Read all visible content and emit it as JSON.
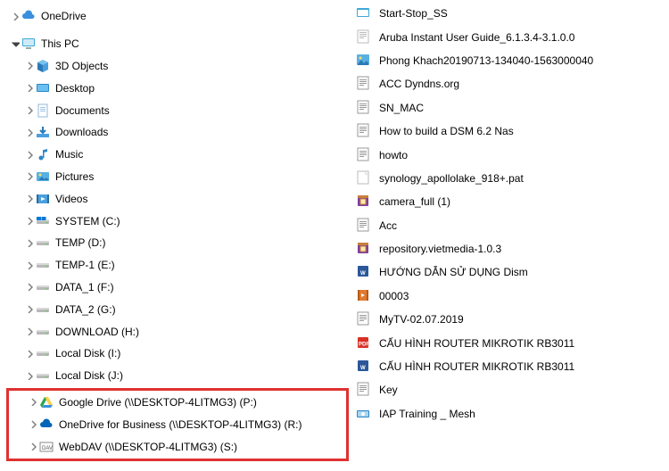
{
  "tree": {
    "onedrive_label": "OneDrive",
    "thispc_label": "This PC",
    "items": [
      {
        "label": "3D Objects"
      },
      {
        "label": "Desktop"
      },
      {
        "label": "Documents"
      },
      {
        "label": "Downloads"
      },
      {
        "label": "Music"
      },
      {
        "label": "Pictures"
      },
      {
        "label": "Videos"
      },
      {
        "label": "SYSTEM (C:)"
      },
      {
        "label": "TEMP (D:)"
      },
      {
        "label": "TEMP-1 (E:)"
      },
      {
        "label": "DATA_1 (F:)"
      },
      {
        "label": "DATA_2 (G:)"
      },
      {
        "label": "DOWNLOAD (H:)"
      },
      {
        "label": "Local Disk (I:)"
      },
      {
        "label": "Local Disk (J:)"
      }
    ],
    "network": [
      {
        "label": "Google Drive (\\\\DESKTOP-4LITMG3) (P:)"
      },
      {
        "label": "OneDrive for Business (\\\\DESKTOP-4LITMG3) (R:)"
      },
      {
        "label": "WebDAV (\\\\DESKTOP-4LITMG3) (S:)"
      }
    ]
  },
  "files": [
    {
      "name": "Start-Stop_SS",
      "icon": "app"
    },
    {
      "name": "Aruba Instant User Guide_6.1.3.4-3.1.0.0",
      "icon": "text"
    },
    {
      "name": "Phong Khach20190713-134040-1563000040",
      "icon": "image"
    },
    {
      "name": "ACC Dyndns.org",
      "icon": "txt"
    },
    {
      "name": "SN_MAC",
      "icon": "txt"
    },
    {
      "name": "How to build a DSM 6.2 Nas",
      "icon": "txt"
    },
    {
      "name": "howto",
      "icon": "txt"
    },
    {
      "name": "synology_apollolake_918+.pat",
      "icon": "generic"
    },
    {
      "name": "camera_full (1)",
      "icon": "rar"
    },
    {
      "name": "Acc",
      "icon": "txt"
    },
    {
      "name": "repository.vietmedia-1.0.3",
      "icon": "rar"
    },
    {
      "name": "HƯỚNG DẪN SỬ DỤNG Dism",
      "icon": "word"
    },
    {
      "name": "00003",
      "icon": "video"
    },
    {
      "name": "MyTV-02.07.2019",
      "icon": "txt"
    },
    {
      "name": "CẤU HÌNH ROUTER MIKROTIK RB3011",
      "icon": "pdf"
    },
    {
      "name": "CẤU HÌNH ROUTER MIKROTIK RB3011",
      "icon": "word"
    },
    {
      "name": "Key",
      "icon": "txt"
    },
    {
      "name": "IAP Training _ Mesh",
      "icon": "app2"
    }
  ]
}
